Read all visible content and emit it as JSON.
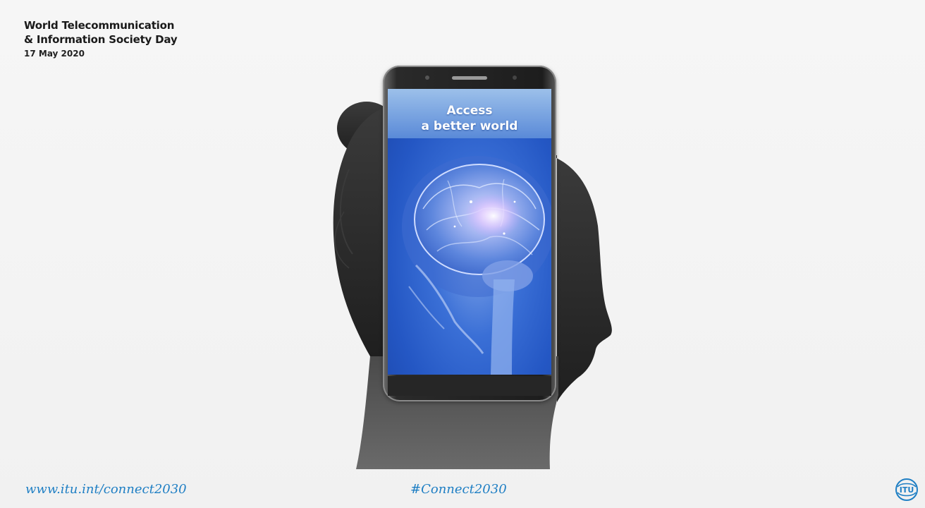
{
  "heading": {
    "line1": "World Telecommunication",
    "line2": "& Information Society Day",
    "date": "17 May 2020"
  },
  "phone_screen": {
    "title_line1": "Access",
    "title_line2": "a better world"
  },
  "footer": {
    "url": "www.itu.int/connect2030",
    "hashtag": "#Connect2030",
    "logo_text": "ITU"
  },
  "colors": {
    "background": "#f4f4f4",
    "link_blue": "#1f7fc4",
    "screen_blue": "#2457c4"
  },
  "icons": {
    "logo": "itu-logo-icon",
    "silhouette": "woman-silhouette-image",
    "brain": "brain-xray-image"
  }
}
